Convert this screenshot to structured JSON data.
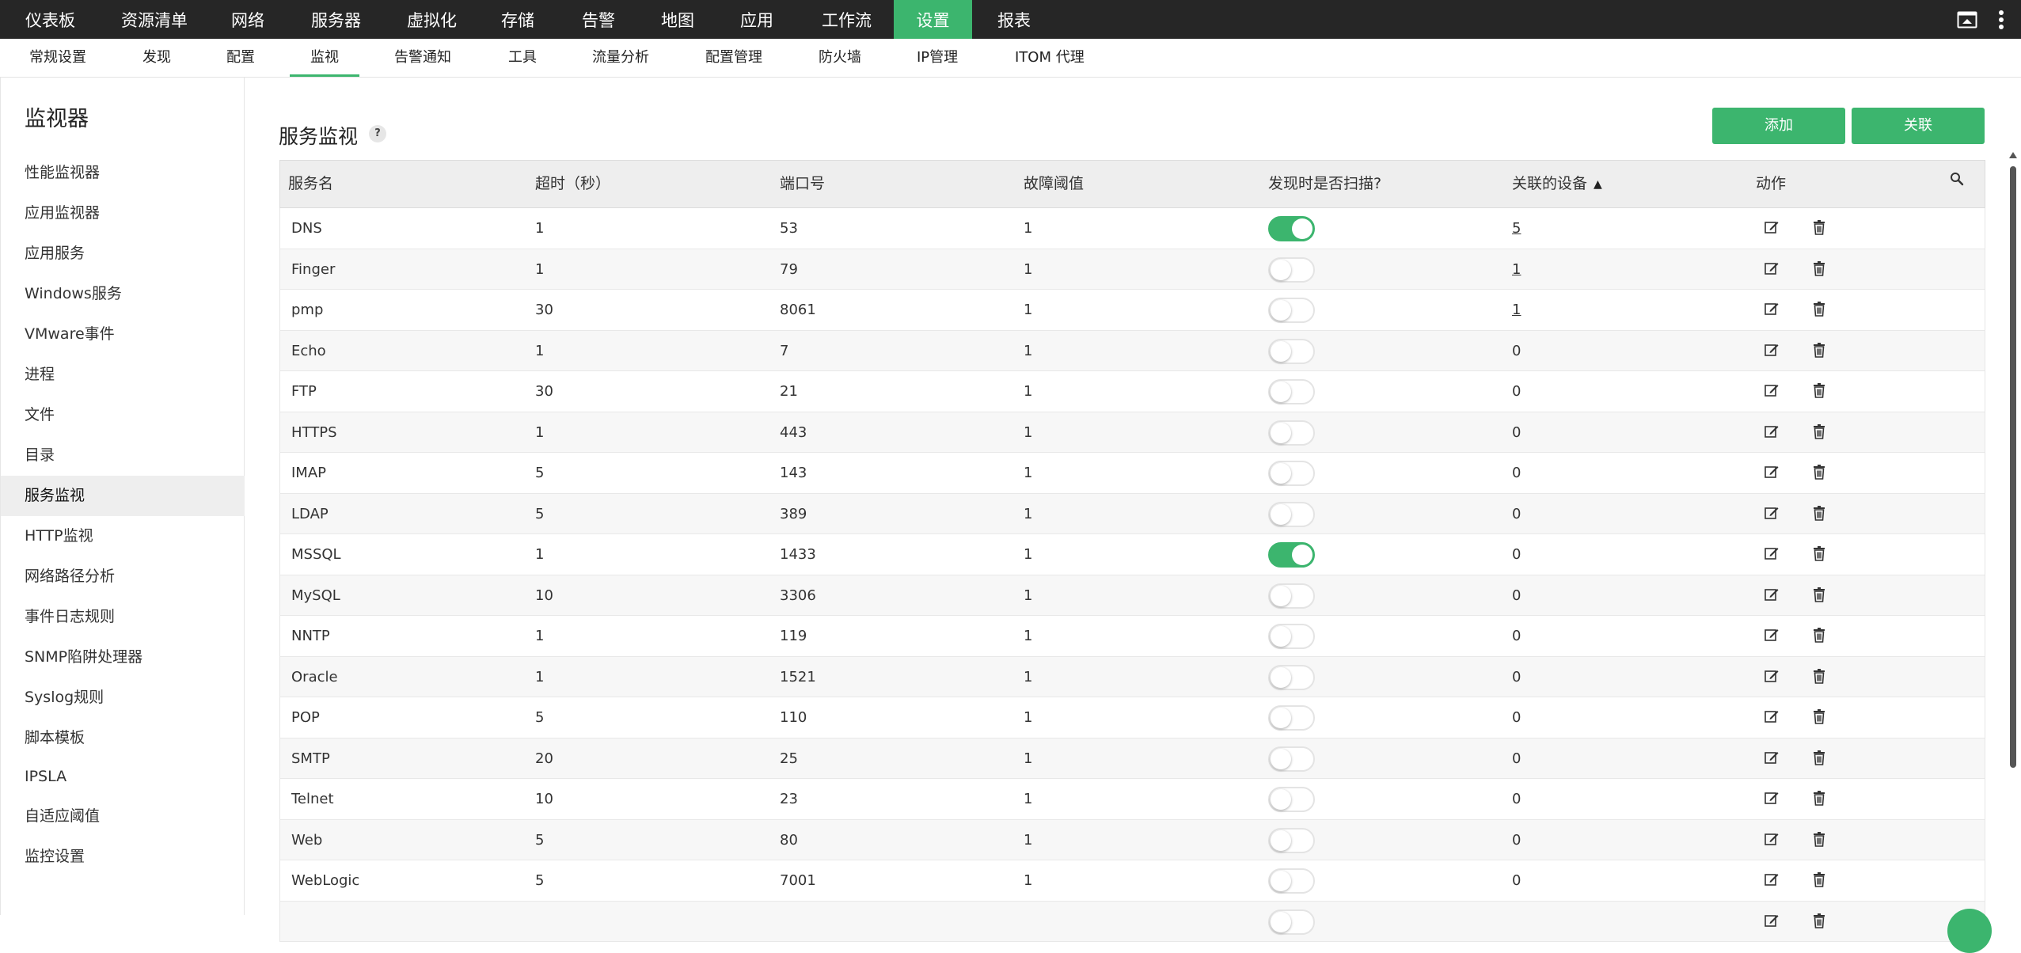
{
  "topnav": {
    "items": [
      "仪表板",
      "资源清单",
      "网络",
      "服务器",
      "虚拟化",
      "存储",
      "告警",
      "地图",
      "应用",
      "工作流",
      "设置",
      "报表"
    ],
    "active": "设置"
  },
  "subnav": {
    "items": [
      "常规设置",
      "发现",
      "配置",
      "监视",
      "告警通知",
      "工具",
      "流量分析",
      "配置管理",
      "防火墙",
      "IP管理",
      "ITOM 代理"
    ],
    "active": "监视"
  },
  "sidebar": {
    "title": "监视器",
    "items": [
      "性能监视器",
      "应用监视器",
      "应用服务",
      "Windows服务",
      "VMware事件",
      "进程",
      "文件",
      "目录",
      "服务监视",
      "HTTP监视",
      "网络路径分析",
      "事件日志规则",
      "SNMP陷阱处理器",
      "Syslog规则",
      "脚本模板",
      "IPSLA",
      "自适应阈值",
      "监控设置"
    ],
    "active": "服务监视"
  },
  "main": {
    "title": "服务监视",
    "help": "?",
    "add_label": "添加",
    "associate_label": "关联"
  },
  "table": {
    "columns": [
      "服务名",
      "超时（秒）",
      "端口号",
      "故障阈值",
      "发现时是否扫描?",
      "关联的设备",
      "动作"
    ],
    "rows": [
      {
        "name": "DNS",
        "timeout": "1",
        "port": "53",
        "threshold": "1",
        "scan": true,
        "devices": "5",
        "link": true
      },
      {
        "name": "Finger",
        "timeout": "1",
        "port": "79",
        "threshold": "1",
        "scan": false,
        "devices": "1",
        "link": true
      },
      {
        "name": "pmp",
        "timeout": "30",
        "port": "8061",
        "threshold": "1",
        "scan": false,
        "devices": "1",
        "link": true
      },
      {
        "name": "Echo",
        "timeout": "1",
        "port": "7",
        "threshold": "1",
        "scan": false,
        "devices": "0",
        "link": false
      },
      {
        "name": "FTP",
        "timeout": "30",
        "port": "21",
        "threshold": "1",
        "scan": false,
        "devices": "0",
        "link": false
      },
      {
        "name": "HTTPS",
        "timeout": "1",
        "port": "443",
        "threshold": "1",
        "scan": false,
        "devices": "0",
        "link": false
      },
      {
        "name": "IMAP",
        "timeout": "5",
        "port": "143",
        "threshold": "1",
        "scan": false,
        "devices": "0",
        "link": false
      },
      {
        "name": "LDAP",
        "timeout": "5",
        "port": "389",
        "threshold": "1",
        "scan": false,
        "devices": "0",
        "link": false
      },
      {
        "name": "MSSQL",
        "timeout": "1",
        "port": "1433",
        "threshold": "1",
        "scan": true,
        "devices": "0",
        "link": false
      },
      {
        "name": "MySQL",
        "timeout": "10",
        "port": "3306",
        "threshold": "1",
        "scan": false,
        "devices": "0",
        "link": false
      },
      {
        "name": "NNTP",
        "timeout": "1",
        "port": "119",
        "threshold": "1",
        "scan": false,
        "devices": "0",
        "link": false
      },
      {
        "name": "Oracle",
        "timeout": "1",
        "port": "1521",
        "threshold": "1",
        "scan": false,
        "devices": "0",
        "link": false
      },
      {
        "name": "POP",
        "timeout": "5",
        "port": "110",
        "threshold": "1",
        "scan": false,
        "devices": "0",
        "link": false
      },
      {
        "name": "SMTP",
        "timeout": "20",
        "port": "25",
        "threshold": "1",
        "scan": false,
        "devices": "0",
        "link": false
      },
      {
        "name": "Telnet",
        "timeout": "10",
        "port": "23",
        "threshold": "1",
        "scan": false,
        "devices": "0",
        "link": false
      },
      {
        "name": "Web",
        "timeout": "5",
        "port": "80",
        "threshold": "1",
        "scan": false,
        "devices": "0",
        "link": false
      },
      {
        "name": "WebLogic",
        "timeout": "5",
        "port": "7001",
        "threshold": "1",
        "scan": false,
        "devices": "0",
        "link": false
      },
      {
        "name": "",
        "timeout": "",
        "port": "",
        "threshold": "",
        "scan": false,
        "devices": "",
        "link": false
      }
    ]
  },
  "colors": {
    "accent": "#3cb56e",
    "topbar": "#262626"
  }
}
